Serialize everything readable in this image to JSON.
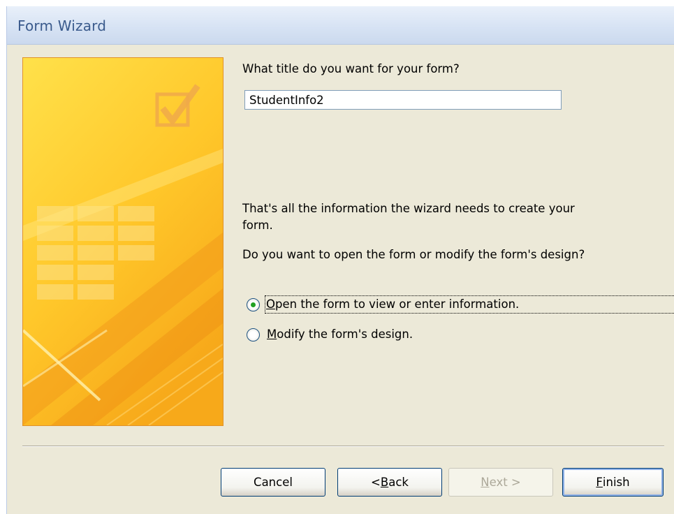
{
  "window": {
    "title": "Form Wizard"
  },
  "art": {
    "icon": "wizard-checkbox-illustration",
    "accent": "#ffd23c"
  },
  "form": {
    "title_prompt": "What title do you want for your form?",
    "title_value": "StudentInfo2",
    "info_line1": "That's all the information the wizard needs to create your",
    "info_line2": "form.",
    "question": "Do you want to open the form or modify the form's design?"
  },
  "options": [
    {
      "access_key": "O",
      "rest": "pen the form to view or enter information.",
      "checked": true
    },
    {
      "access_key": "M",
      "rest": "odify the form's design.",
      "checked": false
    }
  ],
  "buttons": {
    "cancel": "Cancel",
    "back_prefix": "< ",
    "back_key": "B",
    "back_rest": "ack",
    "next_key": "N",
    "next_rest": "ext >",
    "finish_key": "F",
    "finish_rest": "inish"
  }
}
